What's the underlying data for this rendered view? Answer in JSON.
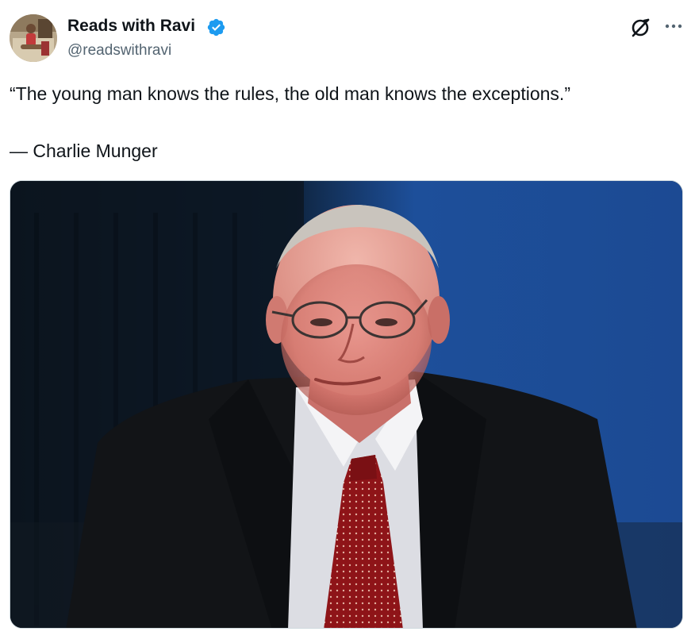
{
  "author": {
    "display_name": "Reads with Ravi",
    "handle": "@readswithravi",
    "verified": true,
    "verified_color": "#1d9bf0",
    "avatar_icon": "profile-avatar-photo"
  },
  "actions": {
    "grok_icon": "grok-icon",
    "more_icon": "more-options-icon"
  },
  "tweet": {
    "quote": "“The young man knows the rules, the old man knows the exceptions.”",
    "attribution": "— Charlie Munger"
  },
  "media": {
    "type": "photo",
    "subject": "photo-of-charlie-munger"
  },
  "colors": {
    "text_primary": "#0f1419",
    "text_secondary": "#536471",
    "border": "#cfd9de"
  }
}
